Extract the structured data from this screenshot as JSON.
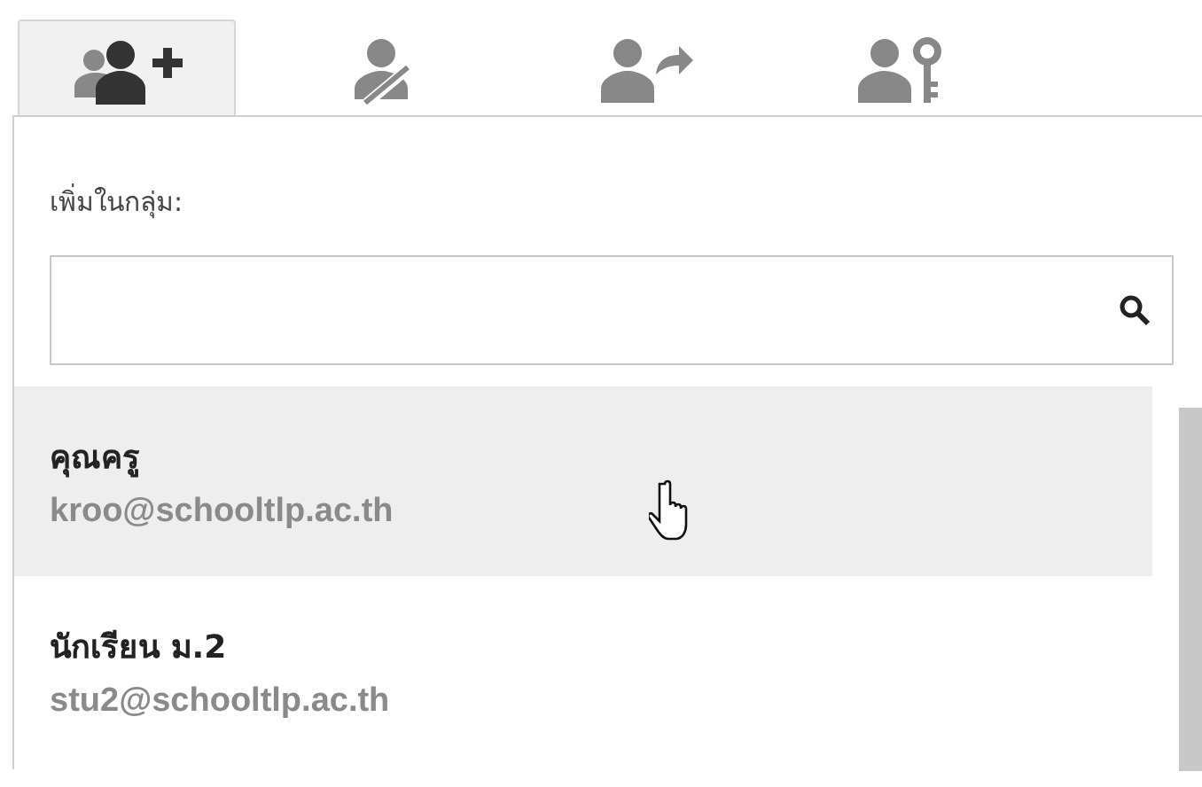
{
  "tabs": [
    {
      "kind": "add-person",
      "selected": true
    },
    {
      "kind": "remove-person",
      "selected": false
    },
    {
      "kind": "share-person",
      "selected": false
    },
    {
      "kind": "key-person",
      "selected": false
    }
  ],
  "panel": {
    "label": "เพิ่มในกลุ่ม:",
    "items": [
      {
        "name": "คุณครู",
        "email": "kroo@schooltlp.ac.th",
        "selected": true
      },
      {
        "name": "นักเรียน ม.2",
        "email": "stu2@schooltlp.ac.th",
        "selected": false
      }
    ]
  }
}
